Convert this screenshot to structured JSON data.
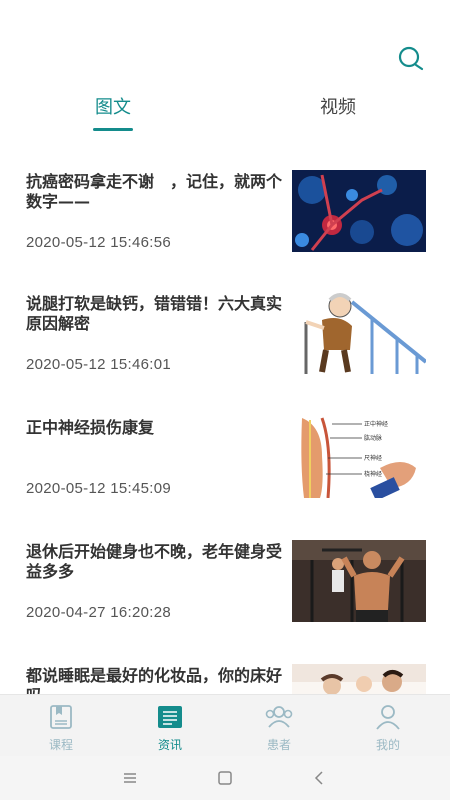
{
  "header": {
    "search_icon": "search-icon"
  },
  "tabs": [
    {
      "label": "图文",
      "active": true
    },
    {
      "label": "视频",
      "active": false
    }
  ],
  "articles": [
    {
      "title": "抗癌密码拿走不谢　，记住，就两个数字——",
      "date": "2020-05-12 15:46:56",
      "thumb": "neuron-cells-image"
    },
    {
      "title": "说腿打软是缺钙，错错错！六大真实原因解密",
      "date": "2020-05-12 15:46:01",
      "thumb": "elderly-man-stairs-image"
    },
    {
      "title": "正中神经损伤康复",
      "date": "2020-05-12 15:45:09",
      "thumb": "arm-nerve-anatomy-image"
    },
    {
      "title": "退休后开始健身也不晚，老年健身受益多多",
      "date": "2020-04-27 16:20:28",
      "thumb": "senior-gym-image"
    },
    {
      "title": "都说睡眠是最好的化妆品，你的床好吗",
      "date": "",
      "thumb": "family-bed-image"
    }
  ],
  "bottom_nav": [
    {
      "label": "课程",
      "icon": "course-book-icon",
      "active": false
    },
    {
      "label": "资讯",
      "icon": "news-icon",
      "active": true
    },
    {
      "label": "患者",
      "icon": "patients-icon",
      "active": false
    },
    {
      "label": "我的",
      "icon": "profile-icon",
      "active": false
    }
  ],
  "colors": {
    "accent": "#148c8c",
    "inactive_nav": "#9bb9c4"
  }
}
